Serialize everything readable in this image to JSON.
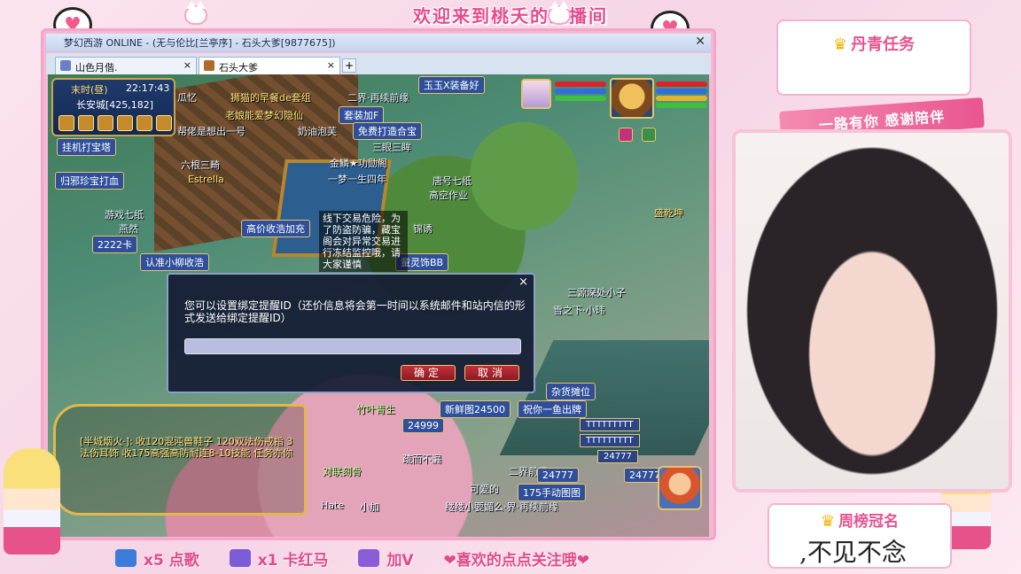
{
  "stream": {
    "banner_title": "欢迎来到桃夭的直播间",
    "task_title": "丹青任务",
    "ribbon_text": "一路有你 感谢陪伴",
    "rank_title": "周榜冠名",
    "rank_name": ",不见不念",
    "bottom_items": [
      {
        "label": "x5 点歌",
        "icon": "ticket-icon",
        "color": "#3b7bd9"
      },
      {
        "label": "x1 卡红马",
        "icon": "rocket-icon",
        "color": "#7c5bd6"
      },
      {
        "label": "加V",
        "icon": "fish-icon",
        "color": "#8a5cd8"
      },
      {
        "label": "❤喜欢的点点关注哦❤",
        "icon": "",
        "color": "#e14a8a"
      }
    ]
  },
  "window": {
    "title": "梦幻西游 ONLINE - (无与伦比[兰亭序] - 石头大爹[9877675])",
    "tabs": [
      {
        "label": "山色月偕.",
        "active": false
      },
      {
        "label": "石头大爹",
        "active": true
      }
    ],
    "add_tab": "+"
  },
  "game": {
    "minimap": {
      "period": "末时(昼)",
      "clock": "22:17:43",
      "location": "长安城[425,182]"
    },
    "overhead_labels": [
      "瓜忆",
      "狮猫的早餐de套组",
      "二界·再续前缘",
      "老娘能爱梦幻隐仙",
      "帮佬是想出一号",
      "奶油泡芙",
      "三眼三眸",
      "金鳞★功勋阁",
      "唐号七纸",
      "高空作业",
      "一梦一生四年",
      "六根三畸",
      "Estrella",
      "游戏七纸",
      "燕然",
      "锦诱",
      "盛乾坤",
      "三源深处小子",
      "雪之下·小玮",
      "竹叶青生",
      "疏而不漏",
      "对联刻骨",
      "可爱的",
      "Hate",
      "小加",
      "缕缕小要媚么·界·再续前缘",
      "二界前缘"
    ],
    "shop_buttons": [
      "玉玉X装备好",
      "套装加F",
      "免费打造合宝",
      "挂机打宝塔",
      "归邪珍宝打血",
      "高价收浩加充",
      "2222卡",
      "认准小柳收浩",
      "童灵饰BB",
      "杂货摊位",
      "新鲜图24500",
      "祝你一鱼出牌",
      "24999",
      "24777",
      "175手动图图",
      "24777"
    ],
    "ttt_labels": [
      "TTTTTTTTT",
      "TTTTTTTTT",
      "24777"
    ],
    "trade_warning": "线下交易危险，为了防盗防骗，藏宝阁会对异常交易进行冻结监控哦，请大家谨慎",
    "chat_message": "[半城烟火·]: 收120混沌兽鞋子 120双法伤戒指 3法伤耳饰 收175高强高防耐连8-10技能 任务亦你"
  },
  "dialog": {
    "message": "您可以设置绑定提醒ID（还价信息将会第一时间以系统邮件和站内信的形式发送给绑定提醒ID）",
    "input_value": "",
    "input_placeholder": "",
    "confirm_label": "确定",
    "cancel_label": "取消",
    "close_label": "×"
  }
}
